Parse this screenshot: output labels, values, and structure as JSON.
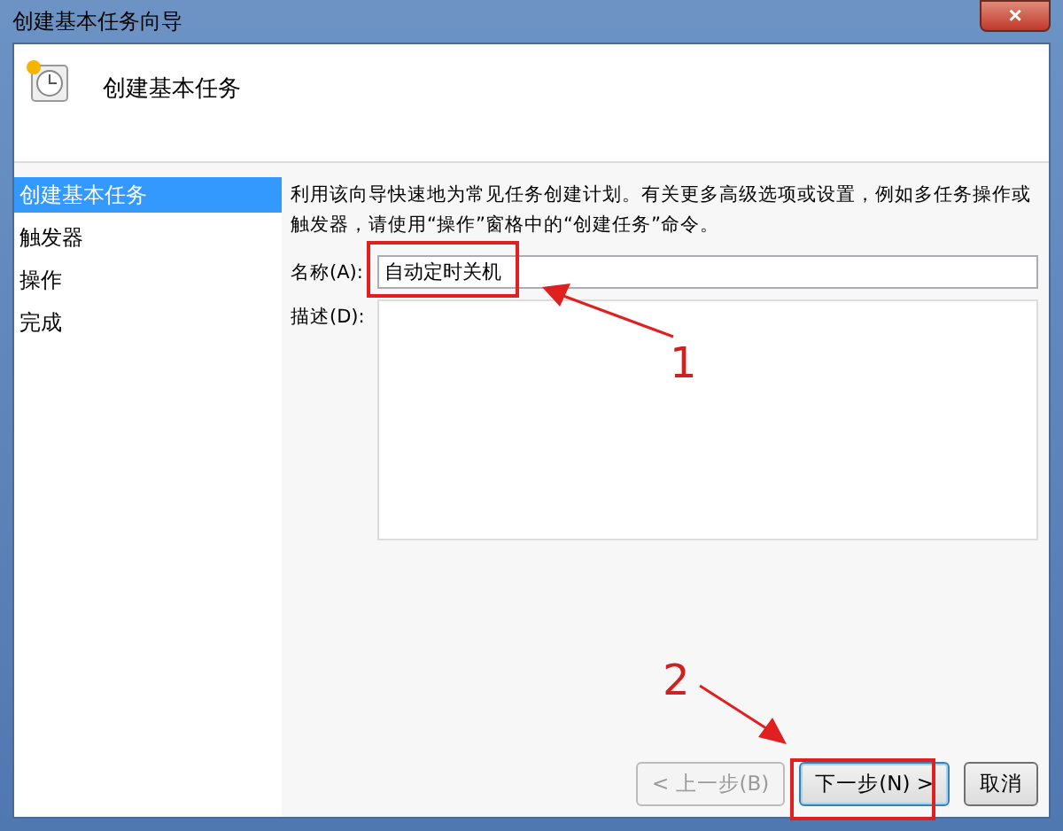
{
  "window": {
    "title": "创建基本任务向导",
    "close_label": "×"
  },
  "header": {
    "title": "创建基本任务"
  },
  "sidebar": {
    "items": [
      {
        "label": "创建基本任务",
        "selected": true
      },
      {
        "label": "触发器",
        "selected": false
      },
      {
        "label": "操作",
        "selected": false
      },
      {
        "label": "完成",
        "selected": false
      }
    ]
  },
  "intro": "利用该向导快速地为常见任务创建计划。有关更多高级选项或设置，例如多任务操作或触发器，请使用“操作”窗格中的“创建任务”命令。",
  "fields": [
    {
      "kind": "input",
      "label": "名称(A):",
      "value": "自动定时关机"
    },
    {
      "kind": "textarea",
      "label": "描述(D):"
    }
  ],
  "buttons": [
    {
      "label": "< 上一步(B)",
      "disabled": true,
      "default": false
    },
    {
      "label": "下一步(N) >",
      "disabled": false,
      "default": true
    },
    {
      "label": "取消",
      "disabled": false,
      "default": false
    }
  ],
  "annotations": [
    {
      "number": "1"
    },
    {
      "number": "2"
    }
  ]
}
